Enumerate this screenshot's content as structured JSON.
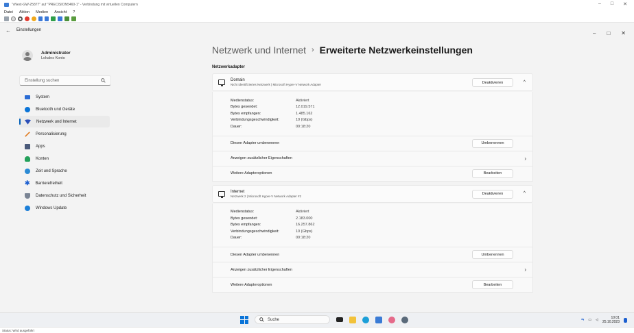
{
  "vm_window": {
    "title": "\"vNext-GW-25877\" auf \"PRECISION5460-1\" - Verbindung mit virtuellen Computern",
    "menu": [
      "Datei",
      "Aktion",
      "Medien",
      "Ansicht",
      "?"
    ],
    "controls": [
      "–",
      "□",
      "✕"
    ]
  },
  "settings": {
    "back_label": "Einstellungen",
    "window_controls": [
      "–",
      "□",
      "✕"
    ],
    "profile": {
      "name": "Administrator",
      "subtitle": "Lokales Konto"
    },
    "search_placeholder": "Einstellung suchen",
    "nav": [
      {
        "label": "System",
        "icon": "monitor-icon",
        "color": "#2b6cd4"
      },
      {
        "label": "Bluetooth und Geräte",
        "icon": "bluetooth-icon",
        "color": "#0a74d8"
      },
      {
        "label": "Netzwerk und Internet",
        "icon": "wifi-icon",
        "color": "#2b4fb8",
        "active": true
      },
      {
        "label": "Personalisierung",
        "icon": "brush-icon",
        "color": "#e07a1f"
      },
      {
        "label": "Apps",
        "icon": "apps-icon",
        "color": "#4a5a7a"
      },
      {
        "label": "Konten",
        "icon": "person-icon",
        "color": "#23a05a"
      },
      {
        "label": "Zeit und Sprache",
        "icon": "globe-clock-icon",
        "color": "#2b8ad4"
      },
      {
        "label": "Barrierefreiheit",
        "icon": "accessibility-icon",
        "color": "#1c5fd0"
      },
      {
        "label": "Datenschutz und Sicherheit",
        "icon": "shield-icon",
        "color": "#7a8494"
      },
      {
        "label": "Windows Update",
        "icon": "update-icon",
        "color": "#1c7fd8"
      }
    ]
  },
  "main": {
    "breadcrumb_parent": "Netzwerk und Internet",
    "breadcrumb_sep": "›",
    "breadcrumb_current": "Erweiterte Netzwerkeinstellungen",
    "section": "Netzwerkadapter",
    "adapters": [
      {
        "name": "Domain",
        "description": "Nicht identifiziertes Netzwerk | Microsoft Hyper-V Network Adapter",
        "toggle_button": "Deaktivieren",
        "details": [
          {
            "label": "Medienstatus:",
            "value": "Aktiviert"
          },
          {
            "label": "Bytes gesendet:",
            "value": "12.019.571"
          },
          {
            "label": "Bytes empfangen:",
            "value": "1.485.162"
          },
          {
            "label": "Verbindungsgeschwindigkeit:",
            "value": "10 (Gbps)"
          },
          {
            "label": "Dauer:",
            "value": "00:18:20"
          }
        ],
        "rename_label": "Diesen Adapter umbenennen",
        "rename_button": "Umbenennen",
        "props_label": "Anzeigen zusätzlicher Eigenschaften",
        "more_label": "Weitere Adapteroptionen",
        "edit_button": "Bearbeiten"
      },
      {
        "name": "Internet",
        "description": "Netzwerk 2 | Microsoft Hyper-V Network Adapter #2",
        "toggle_button": "Deaktivieren",
        "details": [
          {
            "label": "Medienstatus:",
            "value": "Aktiviert"
          },
          {
            "label": "Bytes gesendet:",
            "value": "2.183.000"
          },
          {
            "label": "Bytes empfangen:",
            "value": "16.257.862"
          },
          {
            "label": "Verbindungsgeschwindigkeit:",
            "value": "10 (Gbps)"
          },
          {
            "label": "Dauer:",
            "value": "00:18:20"
          }
        ],
        "rename_label": "Diesen Adapter umbenennen",
        "rename_button": "Umbenennen",
        "props_label": "Anzeigen zusätzlicher Eigenschaften",
        "more_label": "Weitere Adapteroptionen",
        "edit_button": "Bearbeiten"
      }
    ]
  },
  "taskbar": {
    "search_placeholder": "Suche",
    "time": "10:01",
    "date": "25.10.2023"
  },
  "statusbar": {
    "text": "Status: Wird ausgeführt"
  },
  "colors": {
    "accent": "#005fb8",
    "background": "#f3f3f3",
    "card": "#fbfbfb"
  }
}
